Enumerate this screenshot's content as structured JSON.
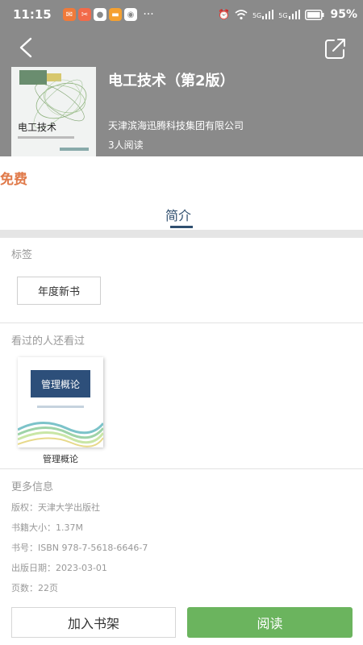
{
  "status_bar": {
    "time": "11:15",
    "more": "···",
    "signal1": "5G",
    "signal2": "5G",
    "battery": "95%"
  },
  "book": {
    "title": "电工技术（第2版）",
    "publisher": "天津滨海迅腾科技集团有限公司",
    "readers": "3人阅读",
    "cover_title": "电工技术"
  },
  "price_label": "免费",
  "tabs": [
    {
      "label": "简介"
    }
  ],
  "tags_section": {
    "title": "标签",
    "tags": [
      "年度新书"
    ]
  },
  "recommend_section": {
    "title": "看过的人还看过",
    "items": [
      {
        "name": "管理概论",
        "cover_text": "管理概论"
      }
    ]
  },
  "more_info": {
    "title": "更多信息",
    "copyright": "版权：天津大学出版社",
    "size": "书籍大小：1.37M",
    "isbn": "书号：ISBN 978-7-5618-6646-7",
    "pub_date": "出版日期：2023-03-01",
    "pages": "页数：22页"
  },
  "actions": {
    "add_shelf": "加入书架",
    "read": "阅读"
  },
  "colors": {
    "header_bg": "#8a8a8a",
    "price": "#e07a4a",
    "tab_active": "#2f4f6f",
    "read_button": "#6bb45e"
  }
}
